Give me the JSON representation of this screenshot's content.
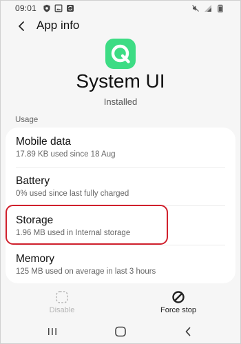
{
  "status_bar": {
    "time": "09:01",
    "left_icons": [
      "shield-icon",
      "image-icon",
      "sync-icon"
    ],
    "right_icons": [
      "mute-icon",
      "signal-icon",
      "battery-icon"
    ]
  },
  "header": {
    "title": "App info",
    "back_icon": "arrow-left-icon"
  },
  "app": {
    "name": "System UI",
    "status": "Installed",
    "icon": "android-q-logo-icon",
    "icon_color": "#3ddc84"
  },
  "usage": {
    "section_label": "Usage",
    "items": [
      {
        "title": "Mobile data",
        "subtitle": "17.89 KB used since 18 Aug"
      },
      {
        "title": "Battery",
        "subtitle": "0% used since last fully charged"
      },
      {
        "title": "Storage",
        "subtitle": "1.96 MB used in Internal storage"
      },
      {
        "title": "Memory",
        "subtitle": "125 MB used on average in last 3 hours"
      }
    ],
    "highlighted_item": "Storage",
    "highlight_color": "#d0202c"
  },
  "actions": {
    "disable": {
      "label": "Disable",
      "enabled": false,
      "icon": "disable-icon"
    },
    "force_stop": {
      "label": "Force stop",
      "enabled": true,
      "icon": "force-stop-icon"
    }
  },
  "nav": {
    "recents_icon": "recents-icon",
    "home_icon": "home-icon",
    "back_icon": "back-chevron-icon"
  },
  "colors": {
    "background": "#f6f6f6",
    "card": "#ffffff",
    "primary_text": "#111111",
    "secondary_text": "#666666",
    "disabled_text": "#b5b5b5"
  }
}
